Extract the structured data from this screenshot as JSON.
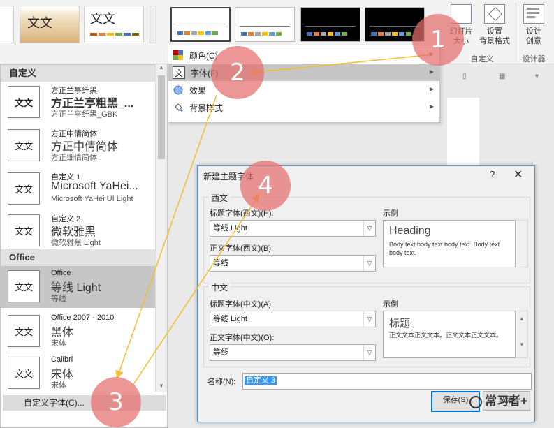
{
  "ribbon": {
    "variant_thumbs": [
      {
        "text": "",
        "kind": "partial"
      },
      {
        "text": "文文",
        "kind": "gold"
      },
      {
        "text": "文文",
        "kind": "plain"
      }
    ],
    "theme_thumbs": [
      {
        "style": "light",
        "selected": true
      },
      {
        "style": "light",
        "selected": false
      },
      {
        "style": "dark",
        "selected": false
      },
      {
        "style": "dark",
        "selected": false
      }
    ],
    "theme_bar_colors": [
      "#4472c4",
      "#ed7d31",
      "#a5a5a5",
      "#ffc000",
      "#5b9bd5",
      "#70ad47"
    ],
    "buttons": {
      "slide_size": "幻灯片\n大小",
      "format_bg": "设置\n背景格式",
      "design_ideas": "设计\n创意"
    },
    "groups": {
      "customize": "自定义",
      "designer": "设计器"
    }
  },
  "menu": {
    "items": [
      {
        "label": "颜色(C)",
        "icon": "color-palette-icon",
        "highlighted": false
      },
      {
        "label": "字体(F)",
        "icon": "font-icon",
        "highlighted": true
      },
      {
        "label": "效果",
        "icon": "effects-icon",
        "highlighted": false
      },
      {
        "label": "背景样式",
        "icon": "bucket-icon",
        "highlighted": false
      }
    ]
  },
  "font_panel": {
    "section_custom": "自定义",
    "section_office": "Office",
    "custom_entries": [
      {
        "thumb": "文文",
        "name": "方正兰亭纤黑",
        "head": "方正兰亭粗黑_...",
        "body": "方正兰亭纤黑_GBK"
      },
      {
        "thumb": "文文",
        "name": "方正中倩简体",
        "head": "方正中倩简体",
        "body": "方正细倩简体"
      },
      {
        "thumb": "文文",
        "name": "自定义 1",
        "head": "Microsoft YaHei...",
        "body": "Microsoft YaHei UI Light"
      },
      {
        "thumb": "文文",
        "name": "自定义 2",
        "head": "微软雅黑",
        "body": "微软雅黑 Light"
      }
    ],
    "office_entries": [
      {
        "thumb": "文文",
        "name": "Office",
        "head": "等线 Light",
        "body": "等线",
        "selected": true
      },
      {
        "thumb": "文文",
        "name": "Office 2007 - 2010",
        "head": "黑体",
        "body": "宋体",
        "selected": false
      },
      {
        "thumb": "文文",
        "name": "Calibri",
        "head": "宋体",
        "body": "宋体",
        "selected": false
      }
    ],
    "custom_fonts_button": "自定义字体(C)..."
  },
  "dialog": {
    "title": "新建主题字体",
    "help": "?",
    "close": "✕",
    "latin_group": "西文",
    "latin_heading_label": "标题字体(西文)(H):",
    "latin_heading_value": "等线 Light",
    "latin_body_label": "正文字体(西文)(B):",
    "latin_body_value": "等线",
    "sample_label": "示例",
    "latin_sample_heading": "Heading",
    "latin_sample_body": "Body text body text body text. Body text body text.",
    "cjk_group": "中文",
    "cjk_heading_label": "标题字体(中文)(A):",
    "cjk_heading_value": "等线 Light",
    "cjk_body_label": "正文字体(中文)(O):",
    "cjk_body_value": "等线",
    "cjk_sample_heading": "标题",
    "cjk_sample_body": "正文文本正文文本。正文文本正文文本。",
    "name_label": "名称(N):",
    "name_value": "自定义 3",
    "save_label": "保存(S)",
    "cancel_label": "取消"
  },
  "callouts": [
    "1",
    "2",
    "3",
    "4"
  ],
  "watermark": "常习者+"
}
